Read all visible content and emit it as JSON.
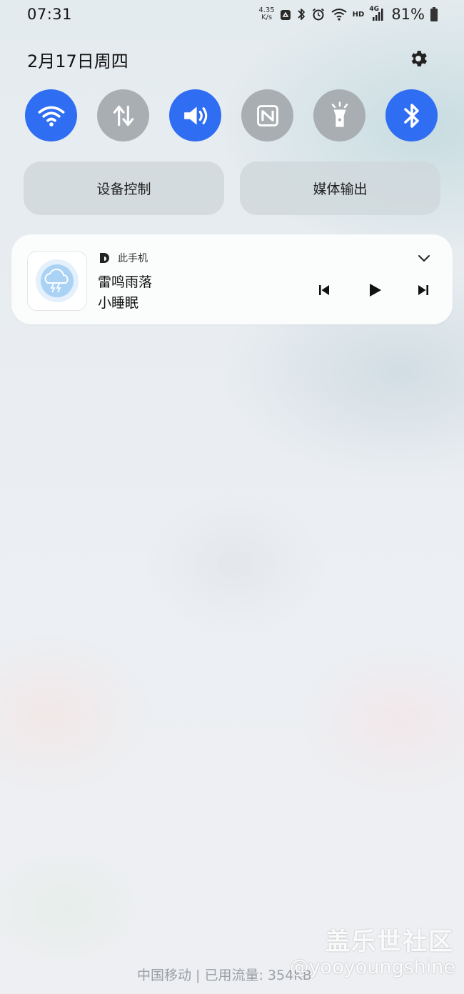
{
  "status_bar": {
    "time": "07:31",
    "net_speed_value": "4.35",
    "net_speed_unit": "K/s",
    "network_badge": "HD",
    "signal_badge": "4G",
    "battery_percent": "81%",
    "icons": [
      "recycle-notification-icon",
      "bluetooth-icon",
      "alarm-icon",
      "wifi-icon",
      "hd-badge",
      "cellular-4g-icon",
      "battery-icon"
    ]
  },
  "header": {
    "date": "2月17日周四"
  },
  "quick_toggles": [
    {
      "id": "wifi",
      "icon": "wifi-icon",
      "state": "on"
    },
    {
      "id": "mobile-data",
      "icon": "data-arrows-icon",
      "state": "off"
    },
    {
      "id": "sound",
      "icon": "speaker-icon",
      "state": "on"
    },
    {
      "id": "nfc",
      "icon": "nfc-icon",
      "state": "off"
    },
    {
      "id": "flashlight",
      "icon": "flashlight-icon",
      "state": "off"
    },
    {
      "id": "bluetooth",
      "icon": "bluetooth-icon",
      "state": "on"
    }
  ],
  "wide_buttons": {
    "device_control": "设备控制",
    "media_output": "媒体输出"
  },
  "media_card": {
    "source": "此手机",
    "title": "雷鸣雨落",
    "artist": "小睡眠",
    "controls": [
      "previous-icon",
      "play-icon",
      "next-icon"
    ]
  },
  "footer": {
    "carrier": "中国移动 | 已用流量: 354KB",
    "watermark_title": "盖乐世社区",
    "watermark_user": "@yooyoungshine"
  },
  "colors": {
    "toggle_on": "#2f6df2",
    "toggle_off": "#a9aeb2",
    "card_bg": "#fbfcfc"
  }
}
